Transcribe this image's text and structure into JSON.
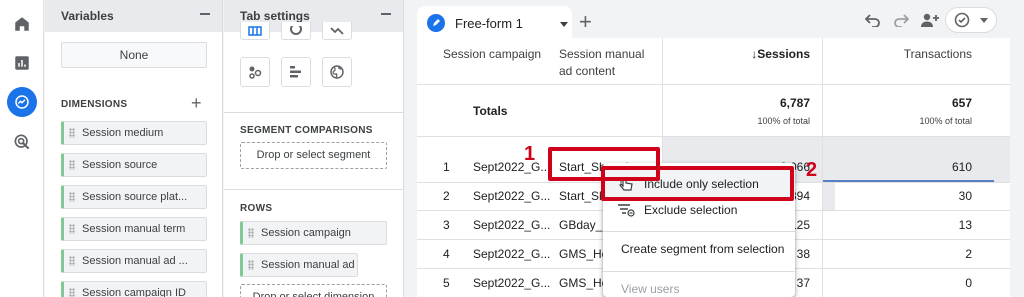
{
  "variables_panel": {
    "title": "Variables",
    "segment_value": "None",
    "dimensions_label": "DIMENSIONS",
    "dimensions": [
      "Session medium",
      "Session source",
      "Session source plat...",
      "Session manual term",
      "Session manual ad ...",
      "Session campaign ID"
    ]
  },
  "tab_settings_panel": {
    "title": "Tab settings",
    "segment_comparisons_label": "SEGMENT COMPARISONS",
    "segment_drop": "Drop or select segment",
    "rows_label": "ROWS",
    "rows": [
      "Session campaign",
      "Session manual ad ..."
    ],
    "dimension_drop": "Drop or select dimension"
  },
  "report": {
    "tab_label": "Free-form 1",
    "columns": {
      "campaign": "Session campaign",
      "ad_content": "Session manual ad content",
      "sessions": "↓Sessions",
      "transactions": "Transactions"
    },
    "totals": {
      "label": "Totals",
      "sessions": "6,787",
      "sessions_pct": "100% of total",
      "transactions": "657",
      "transactions_pct": "100% of total"
    },
    "rows": [
      {
        "n": "1",
        "campaign": "Sept2022_G...",
        "content": "Start_Shopping",
        "sessions": "6,066",
        "transactions": "610"
      },
      {
        "n": "2",
        "campaign": "Sept2022_G...",
        "content": "Start_Sho",
        "sessions": "394",
        "transactions": "30"
      },
      {
        "n": "3",
        "campaign": "Sept2022_G...",
        "content": "GBday_B",
        "sessions": "125",
        "transactions": "13"
      },
      {
        "n": "4",
        "campaign": "Sept2022_G...",
        "content": "GMS_Ho",
        "sessions": "38",
        "transactions": "2"
      },
      {
        "n": "5",
        "campaign": "Sept2022_G...",
        "content": "GMS_Ho",
        "sessions": "37",
        "transactions": "0"
      }
    ]
  },
  "context_menu": {
    "include": "Include only selection",
    "exclude": "Exclude selection",
    "create_segment": "Create segment from selection",
    "view_users": "View users"
  },
  "annotations": {
    "step1": "1",
    "step2": "2"
  },
  "colors": {
    "accent": "#1a73e8",
    "annotation_red": "#d0021b",
    "chip_green": "#81c995"
  }
}
